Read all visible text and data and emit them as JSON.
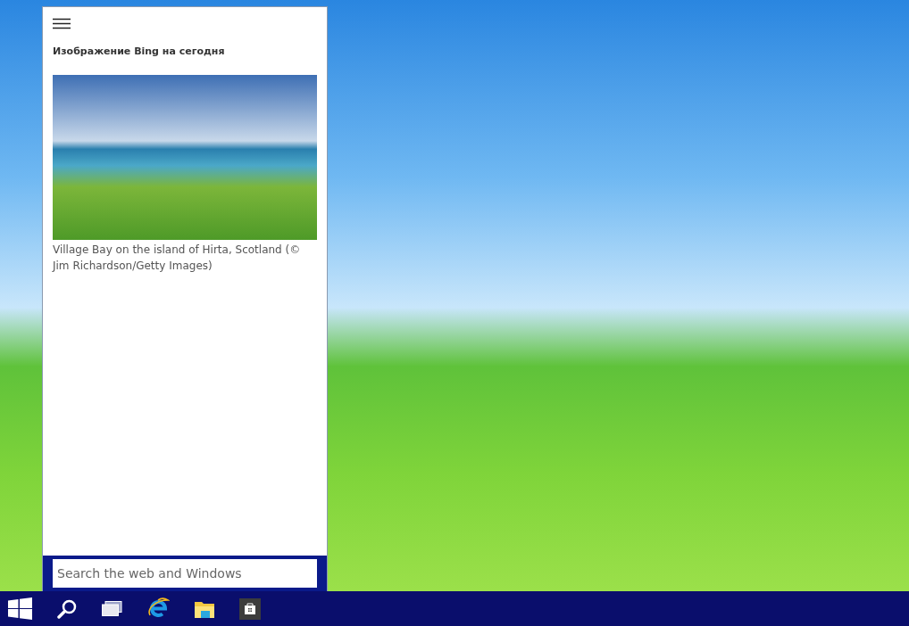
{
  "panel": {
    "heading": "Изображение Bing на сегодня",
    "image_caption": "Village Bay on the island of Hirta, Scotland (© Jim Richardson/Getty Images)"
  },
  "search": {
    "placeholder": "Search the web and Windows"
  }
}
